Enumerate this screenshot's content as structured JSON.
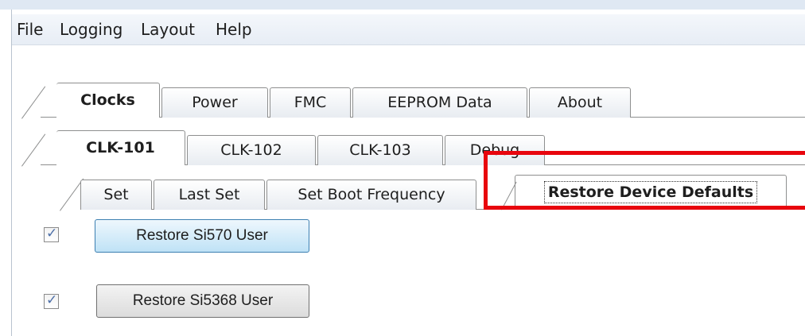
{
  "menu": [
    "File",
    "Logging",
    "Layout",
    "Help"
  ],
  "main_tabs": {
    "items": [
      "Clocks",
      "Power",
      "FMC",
      "EEPROM Data",
      "About"
    ],
    "active": "Clocks"
  },
  "clock_tabs": {
    "items": [
      "CLK-101",
      "CLK-102",
      "CLK-103",
      "Debug"
    ],
    "active": "CLK-101"
  },
  "action_tabs": {
    "items": [
      "Set",
      "Last Set",
      "Set Boot Frequency",
      "Restore Device Defaults"
    ],
    "active": "Restore Device Defaults"
  },
  "options": [
    {
      "checked": true,
      "button_label": "Restore Si570 User"
    },
    {
      "checked": true,
      "button_label": "Restore Si5368 User"
    }
  ],
  "colors": {
    "highlight": "#e8050d",
    "focus_button": "#bfe2f6"
  }
}
